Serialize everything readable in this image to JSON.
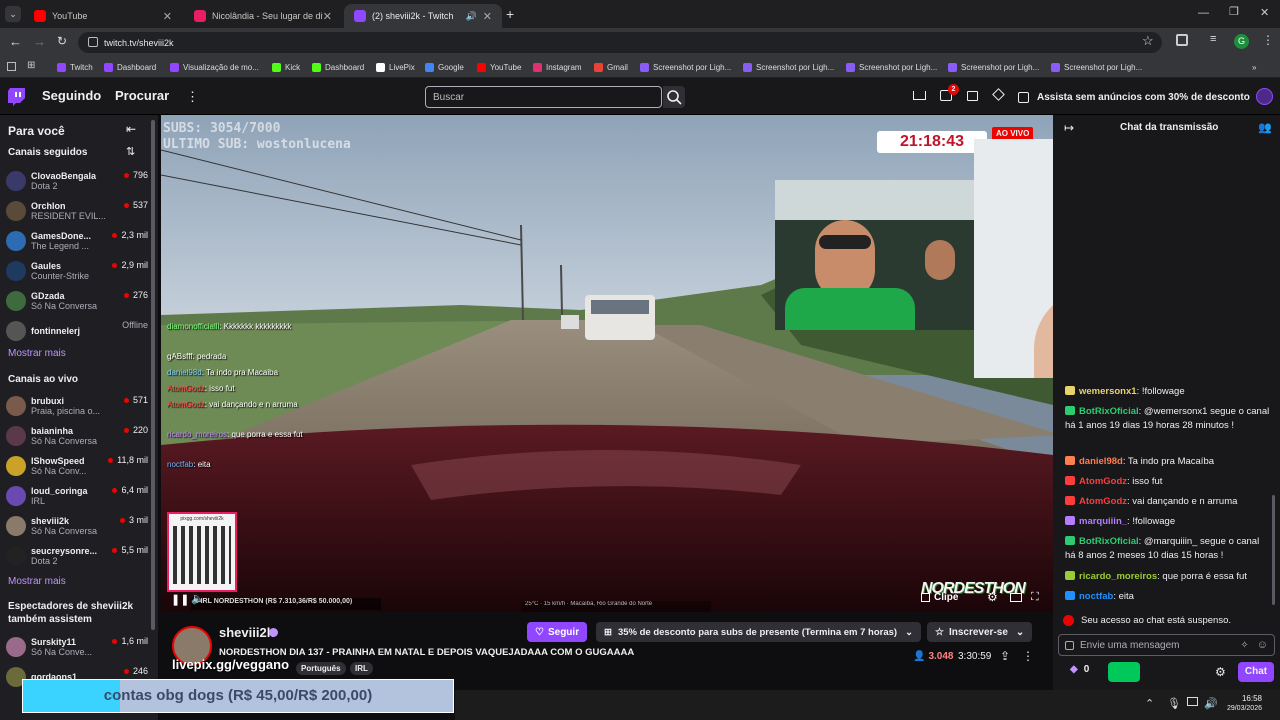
{
  "browser": {
    "tabs": [
      {
        "title": "YouTube",
        "color": "#ff0000"
      },
      {
        "title": "Nicolândia - Seu lugar de diver",
        "color": "#e91e63"
      },
      {
        "title": "(2) sheviii2k - Twitch",
        "color": "#9146ff"
      }
    ],
    "url": "twitch.tv/sheviii2k",
    "profile_initial": "G",
    "bookmarks": [
      "Twitch",
      "Dashboard",
      "Visualização de mo...",
      "Kick",
      "Dashboard",
      "LivePix",
      "Google",
      "YouTube",
      "Instagram",
      "Gmail",
      "Screenshot por Ligh...",
      "Screenshot por Ligh...",
      "Screenshot por Ligh...",
      "Screenshot por Ligh...",
      "Screenshot por Ligh..."
    ]
  },
  "nav": {
    "following": "Seguindo",
    "browse": "Procurar",
    "search_placeholder": "Buscar",
    "notif_badge": "2",
    "promo": "Assista sem anúncios com 30% de desconto"
  },
  "sidebar": {
    "for_you": "Para você",
    "followed_title": "Canais seguidos",
    "followed": [
      {
        "name": "ClovaoBengala",
        "game": "Dota 2",
        "viewers": "796",
        "color": "#3a3a6a"
      },
      {
        "name": "Orchlon",
        "game": "RESIDENT EVIL...",
        "viewers": "537",
        "color": "#5a4a3a"
      },
      {
        "name": "GamesDone...",
        "game": "The Legend ...",
        "viewers": "2,3 mil",
        "color": "#2d6bb3"
      },
      {
        "name": "Gaules",
        "game": "Counter-Strike",
        "viewers": "2,9 mil",
        "color": "#1e3a5f"
      },
      {
        "name": "GDzada",
        "game": "Só Na Conversa",
        "viewers": "276",
        "color": "#3d6b3d"
      },
      {
        "name": "fontinnelerj",
        "game": "",
        "viewers": "Offline",
        "color": "#555"
      }
    ],
    "show_more_1": "Mostrar mais",
    "live_title": "Canais ao vivo",
    "live": [
      {
        "name": "brubuxi",
        "game": "Praia, piscina o...",
        "viewers": "571",
        "color": "#7a5a4a"
      },
      {
        "name": "baianinha",
        "game": "Só Na Conversa",
        "viewers": "220",
        "color": "#5a3a4a"
      },
      {
        "name": "IShowSpeed",
        "game": "Só Na Conv...",
        "viewers": "11,8 mil",
        "color": "#c9a227"
      },
      {
        "name": "loud_coringa",
        "game": "IRL",
        "viewers": "6,4 mil",
        "color": "#6a4ab0"
      },
      {
        "name": "sheviii2k",
        "game": "Só Na Conversa",
        "viewers": "3 mil",
        "color": "#8a7a6a"
      },
      {
        "name": "seucreysonre...",
        "game": "Dota 2",
        "viewers": "5,5 mil",
        "color": "#222"
      }
    ],
    "show_more_2": "Mostrar mais",
    "viewers_title": "Espectadores de sheviii2k também assistem",
    "also": [
      {
        "name": "Surskity11",
        "game": "Só Na Conve...",
        "viewers": "1,6 mil",
        "color": "#9a6a8a"
      },
      {
        "name": "gordaons1",
        "game": "",
        "viewers": "246",
        "color": "#6a6a3a"
      }
    ]
  },
  "player": {
    "subs_overlay": "SUBS: 3054/7000",
    "last_sub": "ULTIMO SUB: wostonlucena",
    "timer": "21:18:43",
    "live_badge": "AO VIVO",
    "qr_url": "pixgg.com/sheviii2k",
    "ticker": "S IRL NORDESTHON (R$ 7.310,36/R$ 50.000,00)",
    "weather": "25°C · 15 km/h · Macaíba, Rio Grande do Norte",
    "clip": "Clipe",
    "brand": "NORDESTHON",
    "overlay_chat": [
      {
        "user": "diamonofficialll",
        "text": ": Kkkkkkk kkkkkkkkk"
      },
      {
        "user": "gABsfff",
        "text": ": pedrada"
      },
      {
        "user": "daniel98d",
        "text": ": Ta indo pra Macaiba"
      },
      {
        "user": "AtomGodz",
        "text": ": isso fut"
      },
      {
        "user": "AtomGodz",
        "text": ": vai dançando e n arruma"
      },
      {
        "user": "ricardo_moreiros",
        "text": ": que porra e essa fut"
      },
      {
        "user": "noctfab",
        "text": ": eita"
      }
    ]
  },
  "stream": {
    "channel": "sheviii2k",
    "title": "NORDESTHON DIA 137 - PRAINHA EM NATAL E DEPOIS VAQUEJADAAA COM O GUGAAAA",
    "follow": "Seguir",
    "gift": "35% de desconto para subs de presente (Termina em 7 horas)",
    "subscribe": "Inscrever-se",
    "tags": [
      "Português",
      "IRL"
    ],
    "viewers": "3.048",
    "uptime": "3:30:59",
    "livepix": "livepix.gg/veggano",
    "donation_bar": "contas obg dogs (R$ 45,00/R$ 200,00)",
    "donation_progress": 0.225
  },
  "chat": {
    "title": "Chat da transmissão",
    "messages": [
      {
        "user": "wemersonx1",
        "text": ": !followage",
        "color": "#e8d26a"
      },
      {
        "user": "BotRixOficial",
        "text": ": @wemersonx1 segue o canal há 1 anos 19 dias 19 horas 28 minutos !",
        "color": "#2ecc71"
      },
      {
        "user": "daniel98d",
        "text": ": Ta indo pra Macaíba",
        "color": "#ff7f50"
      },
      {
        "user": "AtomGodz",
        "text": ": isso fut",
        "color": "#ff3c3c"
      },
      {
        "user": "AtomGodz",
        "text": ": vai dançando e n arruma",
        "color": "#ff3c3c"
      },
      {
        "user": "marquiiin_",
        "text": ": !followage",
        "color": "#b57cff"
      },
      {
        "user": "BotRixOficial",
        "text": ": @marquiiin_ segue o canal há 8 anos 2 meses 10 dias 15 horas !",
        "color": "#2ecc71"
      },
      {
        "user": "ricardo_moreiros",
        "text": ": que porra é essa fut",
        "color": "#9acd32"
      },
      {
        "user": "noctfab",
        "text": ": eita",
        "color": "#1e90ff"
      }
    ],
    "suspended": "Seu acesso ao chat está suspenso.",
    "input_placeholder": "Envie uma mensagem",
    "points": "0",
    "send": "Chat"
  },
  "taskbar": {
    "time": "16:58",
    "date": "29/03/2026"
  }
}
